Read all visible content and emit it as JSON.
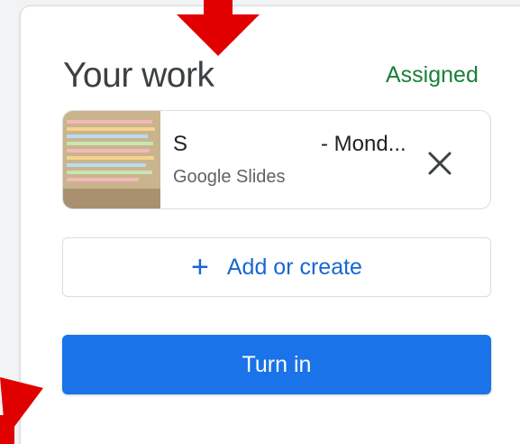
{
  "card": {
    "title": "Your work",
    "status": "Assigned"
  },
  "attachment": {
    "name_start": "S",
    "name_end": "- Mond...",
    "type": "Google Slides",
    "thumbnail_icon": "slides-thumbnail",
    "remove_icon": "close-icon"
  },
  "add_button": {
    "icon": "plus-icon",
    "label": "Add or create"
  },
  "turn_in_button": {
    "label": "Turn in"
  },
  "colors": {
    "accent": "#1a73e8",
    "link": "#1967d2",
    "status": "#188038",
    "annotation_arrow": "#e00000"
  }
}
